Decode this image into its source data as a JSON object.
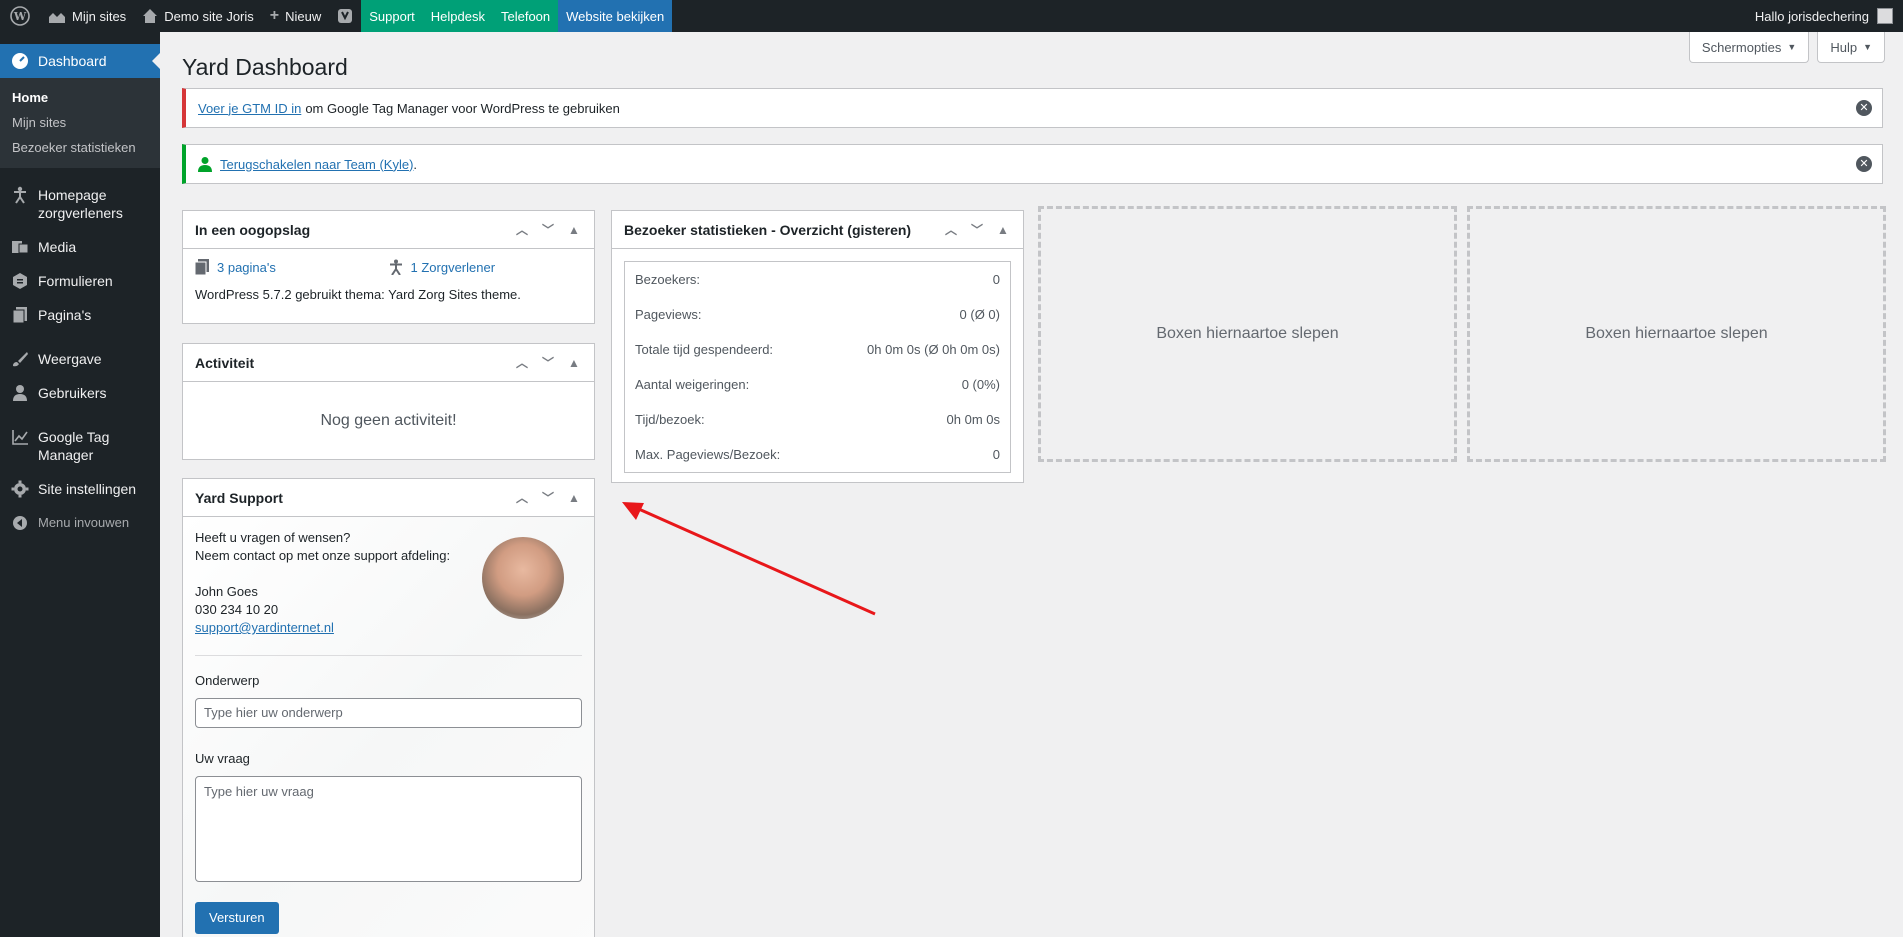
{
  "adminbar": {
    "my_sites": "Mijn sites",
    "site_name": "Demo site Joris",
    "new_label": "Nieuw",
    "support": "Support",
    "helpdesk": "Helpdesk",
    "phone": "Telefoon",
    "view_site": "Website bekijken",
    "greeting": "Hallo jorisdechering"
  },
  "sidebar": {
    "dashboard": "Dashboard",
    "sub": [
      "Home",
      "Mijn sites",
      "Bezoeker statistieken"
    ],
    "items": [
      "Homepage zorgverleners",
      "Media",
      "Formulieren",
      "Pagina's",
      "Weergave",
      "Gebruikers",
      "Google Tag Manager",
      "Site instellingen"
    ],
    "collapse": "Menu invouwen"
  },
  "page": {
    "title": "Yard Dashboard",
    "screen_options": "Schermopties",
    "help": "Hulp"
  },
  "notices": {
    "gtm_link": "Voer je GTM ID in",
    "gtm_text": "om Google Tag Manager voor WordPress te gebruiken",
    "switch_link": "Terugschakelen naar Team (Kyle)",
    "switch_suffix": "."
  },
  "glance": {
    "title": "In een oogopslag",
    "pages": "3 pagina's",
    "providers": "1 Zorgverlener",
    "info": "WordPress 5.7.2 gebruikt thema: Yard Zorg Sites theme."
  },
  "activity": {
    "title": "Activiteit",
    "empty": "Nog geen activiteit!"
  },
  "stats": {
    "title": "Bezoeker statistieken - Overzicht (gisteren)",
    "rows": [
      {
        "label": "Bezoekers:",
        "value": "0"
      },
      {
        "label": "Pageviews:",
        "value": "0 (Ø 0)"
      },
      {
        "label": "Totale tijd gespendeerd:",
        "value": "0h 0m 0s (Ø 0h 0m 0s)"
      },
      {
        "label": "Aantal weigeringen:",
        "value": "0 (0%)"
      },
      {
        "label": "Tijd/bezoek:",
        "value": "0h 0m 0s"
      },
      {
        "label": "Max. Pageviews/Bezoek:",
        "value": "0"
      }
    ]
  },
  "dropzone": {
    "label": "Boxen hiernaartoe slepen"
  },
  "support": {
    "title": "Yard Support",
    "intro1": "Heeft u vragen of wensen?",
    "intro2": "Neem contact op met onze support afdeling:",
    "name": "John Goes",
    "phone": "030 234 10 20",
    "email": "support@yardinternet.nl",
    "subject_label": "Onderwerp",
    "subject_placeholder": "Type hier uw onderwerp",
    "question_label": "Uw vraag",
    "question_placeholder": "Type hier uw vraag",
    "send": "Versturen"
  }
}
